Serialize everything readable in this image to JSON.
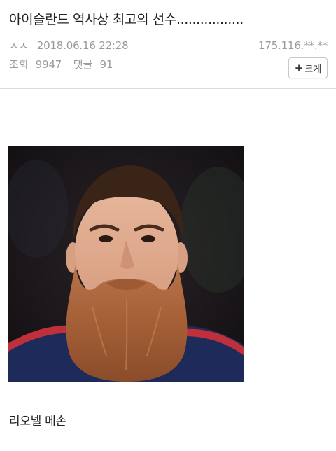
{
  "post": {
    "title": "아이슬란드 역사상 최고의 선수.................",
    "author": "ㅈㅈ",
    "date": "2018.06.16 22:28",
    "ip": "175.116.**.**",
    "views_label": "조회",
    "views_value": "9947",
    "comments_label": "댓글",
    "comments_value": "91",
    "font_button_label": "크게",
    "body_text": "리오넬 메손"
  },
  "icons": {
    "font_button_icon": "plus-icon"
  },
  "colors": {
    "meta_text": "#9a9a9a",
    "divider": "#dcdcdc",
    "title_text": "#222222"
  }
}
